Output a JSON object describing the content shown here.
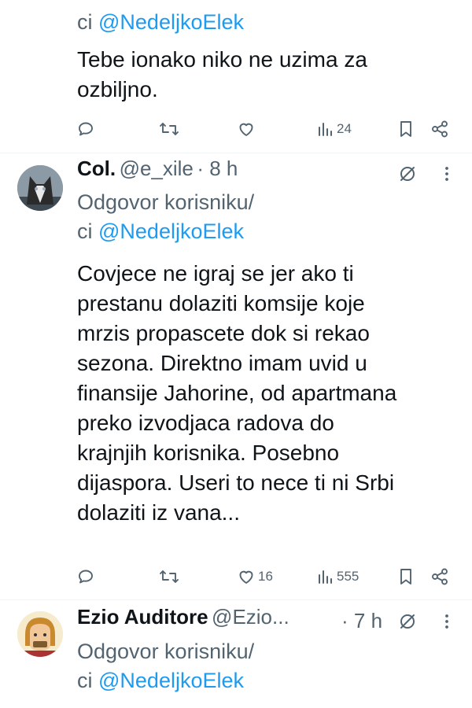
{
  "tweets": [
    {
      "reply_prefix": "ci ",
      "mention": "@NedeljkoElek",
      "text_lines": [
        "Tebe ionako niko ne uzima za",
        "ozbiljno."
      ],
      "stats": {
        "replies": "",
        "retweets": "",
        "likes": "",
        "views": "24"
      }
    },
    {
      "name": "Col.",
      "handle": "@e_xile",
      "time": "· 8 h",
      "reply_line1": "Odgovor korisniku/",
      "reply_prefix": "ci ",
      "mention": "@NedeljkoElek",
      "text_lines": [
        "Covjece ne igraj se jer ako ti",
        "prestanu dolaziti komsije koje",
        "mrzis propascete dok si rekao",
        "sezona. Direktno imam uvid u",
        "finansije Jahorine, od apartmana",
        "preko izvodjaca radova do",
        "krajnjih korisnika. Posebno",
        "dijaspora. Useri to nece ti ni Srbi",
        "dolaziti iz vana..."
      ],
      "stats": {
        "replies": "",
        "retweets": "",
        "likes": "16",
        "views": "555"
      }
    },
    {
      "name": "Ezio Auditore",
      "handle": "@Ezio...",
      "time": "· 7 h",
      "reply_line1": "Odgovor korisniku/",
      "reply_prefix": "ci ",
      "mention": "@NedeljkoElek"
    }
  ],
  "icons": {
    "reply": "reply-icon",
    "retweet": "retweet-icon",
    "like": "heart-icon",
    "views": "views-icon",
    "bookmark": "bookmark-icon",
    "share": "share-icon",
    "grok": "grok-icon",
    "more": "more-icon"
  },
  "colors": {
    "mention": "#1d9bf0",
    "muted": "#536471",
    "text": "#0f1419"
  }
}
